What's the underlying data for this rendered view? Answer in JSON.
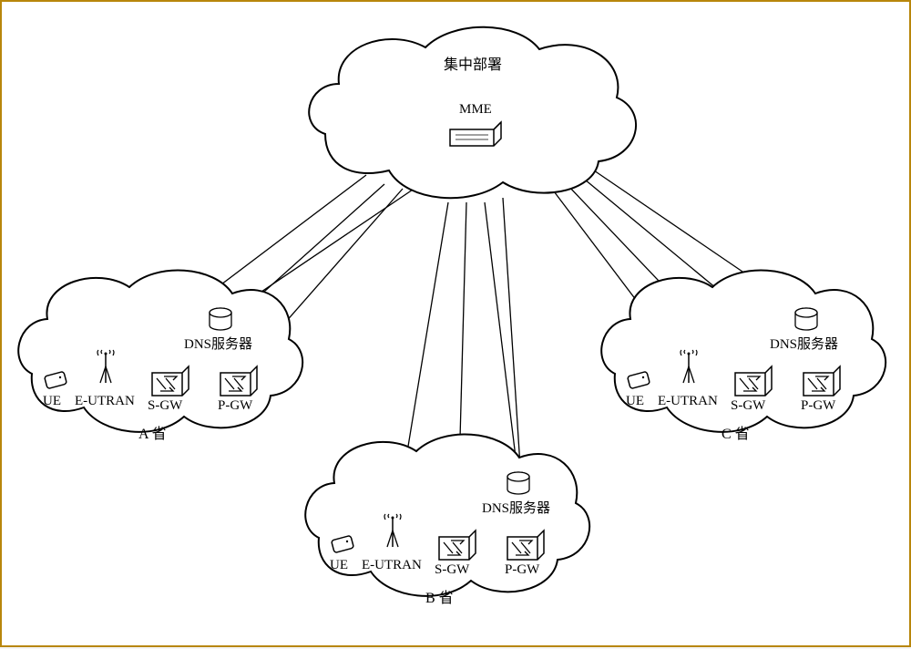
{
  "top_cloud": {
    "title": "集中部署",
    "device_label": "MME"
  },
  "province_a": {
    "name": "A 省",
    "ue": "UE",
    "eutran": "E-UTRAN",
    "sgw": "S-GW",
    "pgw": "P-GW",
    "dns": "DNS服务器"
  },
  "province_b": {
    "name": "B 省",
    "ue": "UE",
    "eutran": "E-UTRAN",
    "sgw": "S-GW",
    "pgw": "P-GW",
    "dns": "DNS服务器"
  },
  "province_c": {
    "name": "C 省",
    "ue": "UE",
    "eutran": "E-UTRAN",
    "sgw": "S-GW",
    "pgw": "P-GW",
    "dns": "DNS服务器"
  }
}
